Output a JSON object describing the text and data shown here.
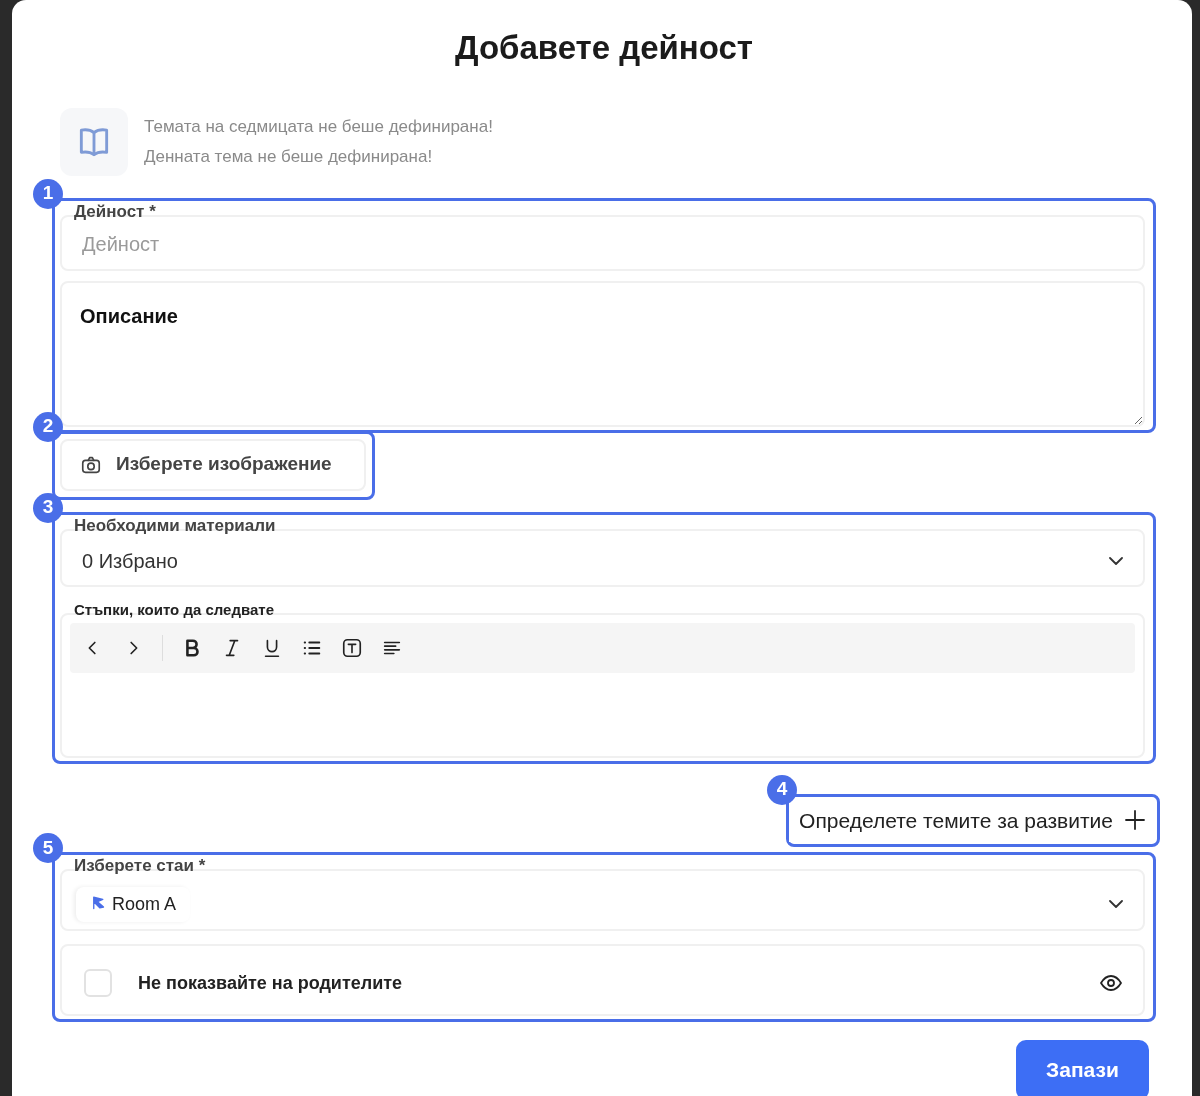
{
  "dialog": {
    "title": "Добавете дейност"
  },
  "theme_notice": {
    "lines": [
      "Темата на седмицата не беше дефинирана!",
      "Денната тема не беше дефинирана!"
    ]
  },
  "activity": {
    "badge": "1",
    "label": "Дейност *",
    "placeholder": "Дейност",
    "description_placeholder": "Описание"
  },
  "image": {
    "badge": "2",
    "button": "Изберете изображение"
  },
  "materials": {
    "badge": "3",
    "label": "Необходими материали",
    "value": "0 Избрано",
    "steps_label": "Стъпки, които да следвате",
    "toolbar": [
      {
        "kind": "undo"
      },
      {
        "kind": "redo"
      },
      {
        "kind": "divider"
      },
      {
        "kind": "bold"
      },
      {
        "kind": "italic"
      },
      {
        "kind": "underline"
      },
      {
        "kind": "list"
      },
      {
        "kind": "textbox"
      },
      {
        "kind": "align"
      }
    ]
  },
  "themes": {
    "badge": "4",
    "link": "Определете темите за развитие"
  },
  "rooms": {
    "badge": "5",
    "label": "Изберете стаи *",
    "chips": [
      "Room A"
    ],
    "hide_from_parents": {
      "label": "Не показвайте на родителите",
      "checked": false
    }
  },
  "save_button": "Запази"
}
